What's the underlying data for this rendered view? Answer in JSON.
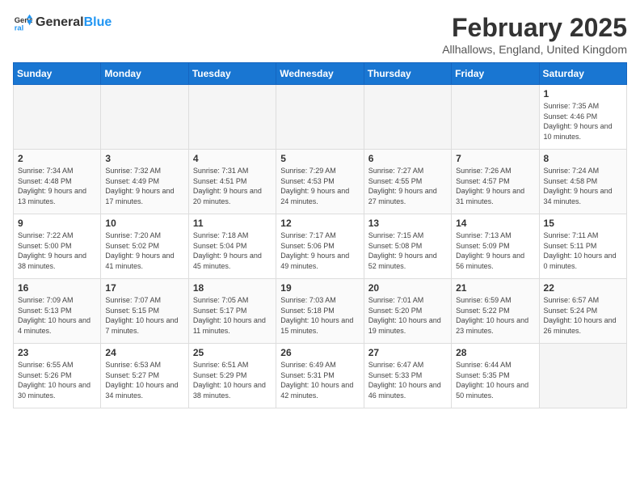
{
  "logo": {
    "general": "General",
    "blue": "Blue"
  },
  "header": {
    "month": "February 2025",
    "location": "Allhallows, England, United Kingdom"
  },
  "weekdays": [
    "Sunday",
    "Monday",
    "Tuesday",
    "Wednesday",
    "Thursday",
    "Friday",
    "Saturday"
  ],
  "weeks": [
    [
      {
        "day": "",
        "empty": true
      },
      {
        "day": "",
        "empty": true
      },
      {
        "day": "",
        "empty": true
      },
      {
        "day": "",
        "empty": true
      },
      {
        "day": "",
        "empty": true
      },
      {
        "day": "",
        "empty": true
      },
      {
        "day": "1",
        "sunrise": "7:35 AM",
        "sunset": "4:46 PM",
        "daylight": "9 hours and 10 minutes."
      }
    ],
    [
      {
        "day": "2",
        "sunrise": "7:34 AM",
        "sunset": "4:48 PM",
        "daylight": "9 hours and 13 minutes."
      },
      {
        "day": "3",
        "sunrise": "7:32 AM",
        "sunset": "4:49 PM",
        "daylight": "9 hours and 17 minutes."
      },
      {
        "day": "4",
        "sunrise": "7:31 AM",
        "sunset": "4:51 PM",
        "daylight": "9 hours and 20 minutes."
      },
      {
        "day": "5",
        "sunrise": "7:29 AM",
        "sunset": "4:53 PM",
        "daylight": "9 hours and 24 minutes."
      },
      {
        "day": "6",
        "sunrise": "7:27 AM",
        "sunset": "4:55 PM",
        "daylight": "9 hours and 27 minutes."
      },
      {
        "day": "7",
        "sunrise": "7:26 AM",
        "sunset": "4:57 PM",
        "daylight": "9 hours and 31 minutes."
      },
      {
        "day": "8",
        "sunrise": "7:24 AM",
        "sunset": "4:58 PM",
        "daylight": "9 hours and 34 minutes."
      }
    ],
    [
      {
        "day": "9",
        "sunrise": "7:22 AM",
        "sunset": "5:00 PM",
        "daylight": "9 hours and 38 minutes."
      },
      {
        "day": "10",
        "sunrise": "7:20 AM",
        "sunset": "5:02 PM",
        "daylight": "9 hours and 41 minutes."
      },
      {
        "day": "11",
        "sunrise": "7:18 AM",
        "sunset": "5:04 PM",
        "daylight": "9 hours and 45 minutes."
      },
      {
        "day": "12",
        "sunrise": "7:17 AM",
        "sunset": "5:06 PM",
        "daylight": "9 hours and 49 minutes."
      },
      {
        "day": "13",
        "sunrise": "7:15 AM",
        "sunset": "5:08 PM",
        "daylight": "9 hours and 52 minutes."
      },
      {
        "day": "14",
        "sunrise": "7:13 AM",
        "sunset": "5:09 PM",
        "daylight": "9 hours and 56 minutes."
      },
      {
        "day": "15",
        "sunrise": "7:11 AM",
        "sunset": "5:11 PM",
        "daylight": "10 hours and 0 minutes."
      }
    ],
    [
      {
        "day": "16",
        "sunrise": "7:09 AM",
        "sunset": "5:13 PM",
        "daylight": "10 hours and 4 minutes."
      },
      {
        "day": "17",
        "sunrise": "7:07 AM",
        "sunset": "5:15 PM",
        "daylight": "10 hours and 7 minutes."
      },
      {
        "day": "18",
        "sunrise": "7:05 AM",
        "sunset": "5:17 PM",
        "daylight": "10 hours and 11 minutes."
      },
      {
        "day": "19",
        "sunrise": "7:03 AM",
        "sunset": "5:18 PM",
        "daylight": "10 hours and 15 minutes."
      },
      {
        "day": "20",
        "sunrise": "7:01 AM",
        "sunset": "5:20 PM",
        "daylight": "10 hours and 19 minutes."
      },
      {
        "day": "21",
        "sunrise": "6:59 AM",
        "sunset": "5:22 PM",
        "daylight": "10 hours and 23 minutes."
      },
      {
        "day": "22",
        "sunrise": "6:57 AM",
        "sunset": "5:24 PM",
        "daylight": "10 hours and 26 minutes."
      }
    ],
    [
      {
        "day": "23",
        "sunrise": "6:55 AM",
        "sunset": "5:26 PM",
        "daylight": "10 hours and 30 minutes."
      },
      {
        "day": "24",
        "sunrise": "6:53 AM",
        "sunset": "5:27 PM",
        "daylight": "10 hours and 34 minutes."
      },
      {
        "day": "25",
        "sunrise": "6:51 AM",
        "sunset": "5:29 PM",
        "daylight": "10 hours and 38 minutes."
      },
      {
        "day": "26",
        "sunrise": "6:49 AM",
        "sunset": "5:31 PM",
        "daylight": "10 hours and 42 minutes."
      },
      {
        "day": "27",
        "sunrise": "6:47 AM",
        "sunset": "5:33 PM",
        "daylight": "10 hours and 46 minutes."
      },
      {
        "day": "28",
        "sunrise": "6:44 AM",
        "sunset": "5:35 PM",
        "daylight": "10 hours and 50 minutes."
      },
      {
        "day": "",
        "empty": true
      }
    ]
  ]
}
